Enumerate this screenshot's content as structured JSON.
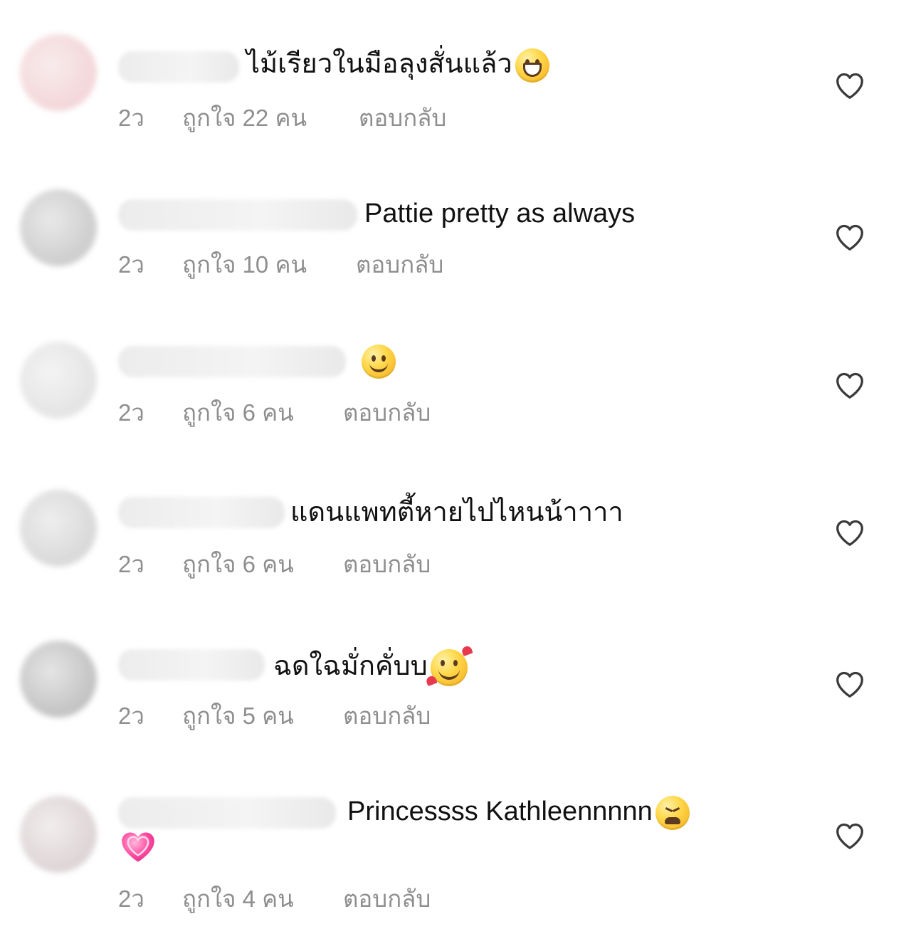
{
  "comments": [
    {
      "avatar_color": "#f4d9dc",
      "comment_text": "ไม้เรียวในมือลุงสั่นแล้ว",
      "emoji": "grinning-face",
      "time": "2ว",
      "likes": "ถูกใจ 22 คน",
      "reply_label": "ตอบกลับ"
    },
    {
      "avatar_color": "#d9d9d9",
      "comment_text": "Pattie pretty as always",
      "emoji": "",
      "time": "2ว",
      "likes": "ถูกใจ 10 คน",
      "reply_label": "ตอบกลับ"
    },
    {
      "avatar_color": "#e9e9e9",
      "comment_text": "",
      "emoji": "slightly-smiling-face",
      "time": "2ว",
      "likes": "ถูกใจ 6 คน",
      "reply_label": "ตอบกลับ"
    },
    {
      "avatar_color": "#dcdcdc",
      "comment_text": "แดนแพทตี้หายไปไหนน้าาาา",
      "emoji": "",
      "time": "2ว",
      "likes": "ถูกใจ 6 คน",
      "reply_label": "ตอบกลับ"
    },
    {
      "avatar_color": "#cfcfcf",
      "comment_text": "ฉดใฉมั่กคั่บบ",
      "emoji": "smiling-face-with-hearts",
      "time": "2ว",
      "likes": "ถูกใจ 5 คน",
      "reply_label": "ตอบกลับ"
    },
    {
      "avatar_color": "#e7dfdf",
      "comment_text": "Princessss Kathleennnnn",
      "emoji": "tired-face",
      "extra_emoji": "growing-heart",
      "time": "2ว",
      "likes": "ถูกใจ 4 คน",
      "reply_label": "ตอบกลับ"
    }
  ],
  "colors": {
    "meta_text": "#8e8e8e",
    "comment_text": "#111111",
    "icon": "#3a3a3a",
    "heart_pink": "#ff4fa3"
  },
  "icons": {
    "like": "heart-outline-icon"
  }
}
